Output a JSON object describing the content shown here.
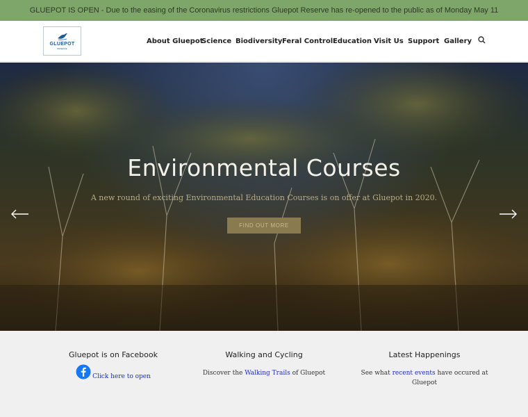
{
  "announcement": "GLUEPOT IS OPEN - Due to the easing of the Coronavirus restrictions Gluepot Reserve has re-opened to the public as of Monday May 11",
  "logo": {
    "name": "GLUEPOT",
    "sub": "RESERVE"
  },
  "nav": {
    "items": [
      {
        "label": "About Gluepot"
      },
      {
        "label": "Science"
      },
      {
        "label": "Biodiversity"
      },
      {
        "label": "Feral Control"
      },
      {
        "label": "Education"
      },
      {
        "label": "Visit Us"
      },
      {
        "label": "Support"
      },
      {
        "label": "Gallery"
      }
    ],
    "search_icon": "search-icon"
  },
  "hero": {
    "title": "Environmental Courses",
    "subtitle": "A new round of exciting Environmental Education Courses is on offer at Gluepot in 2020.",
    "button": "FIND OUT MORE",
    "prev_icon": "arrow-left-icon",
    "next_icon": "arrow-right-icon"
  },
  "footer": {
    "facebook": {
      "title": "Gluepot is on Facebook",
      "link": "Click here to open",
      "icon": "facebook-icon"
    },
    "walking": {
      "title": "Walking and Cycling",
      "pre": "Discover the ",
      "link": "Walking Trails",
      "post": " of Gluepot"
    },
    "happenings": {
      "title": "Latest Happenings",
      "pre": "See what ",
      "link": "recent events",
      "post": " have occured at Gluepot"
    }
  },
  "colors": {
    "topbar": "#7fa66a",
    "link": "#1a2fcc",
    "button": "#8a7a4f",
    "footer_bg": "#f0f0f0"
  }
}
